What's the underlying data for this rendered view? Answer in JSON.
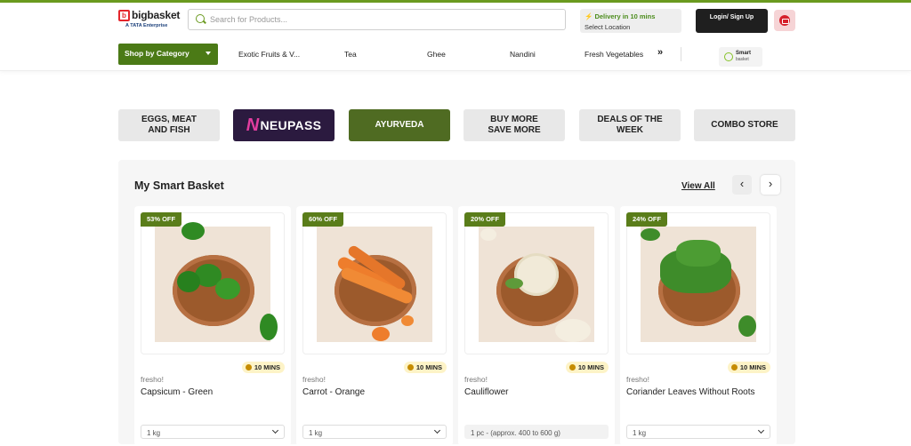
{
  "header": {
    "logo_name": "bigbasket",
    "logo_tag": "A TATA Enterprise",
    "search_placeholder": "Search for Products...",
    "delivery_title": "Delivery in 10 mins",
    "delivery_sub": "Select Location",
    "login_label": "Login/ Sign Up",
    "shop_by_category": "Shop by Category",
    "nav_links": [
      "Exotic Fruits & V...",
      "Tea",
      "Ghee",
      "Nandini",
      "Fresh Vegetables"
    ],
    "smart_label": "Smart",
    "smart_sub": "basket"
  },
  "tiles": [
    "EGGS, MEAT AND FISH",
    "NEUPASS",
    "AYURVEDA",
    "BUY MORE SAVE MORE",
    "DEALS OF THE WEEK",
    "COMBO STORE"
  ],
  "basket": {
    "title": "My Smart Basket",
    "view_all": "View All",
    "products": [
      {
        "discount": "53% OFF",
        "eta": "10 MINS",
        "brand": "fresho!",
        "name": "Capsicum - Green",
        "qty": "1 kg",
        "veg_color": "#2f8a23"
      },
      {
        "discount": "60% OFF",
        "eta": "10 MINS",
        "brand": "fresho!",
        "name": "Carrot - Orange",
        "qty": "1 kg",
        "veg_color": "#ee7d2c"
      },
      {
        "discount": "20% OFF",
        "eta": "10 MINS",
        "brand": "fresho!",
        "name": "Cauliflower",
        "qty": "1 pc - (approx. 400 to 600 g)",
        "veg_color": "#f1ead8"
      },
      {
        "discount": "24% OFF",
        "eta": "10 MINS",
        "brand": "fresho!",
        "name": "Coriander Leaves Without Roots",
        "qty": "1 kg",
        "veg_color": "#3e8c2a"
      }
    ]
  }
}
